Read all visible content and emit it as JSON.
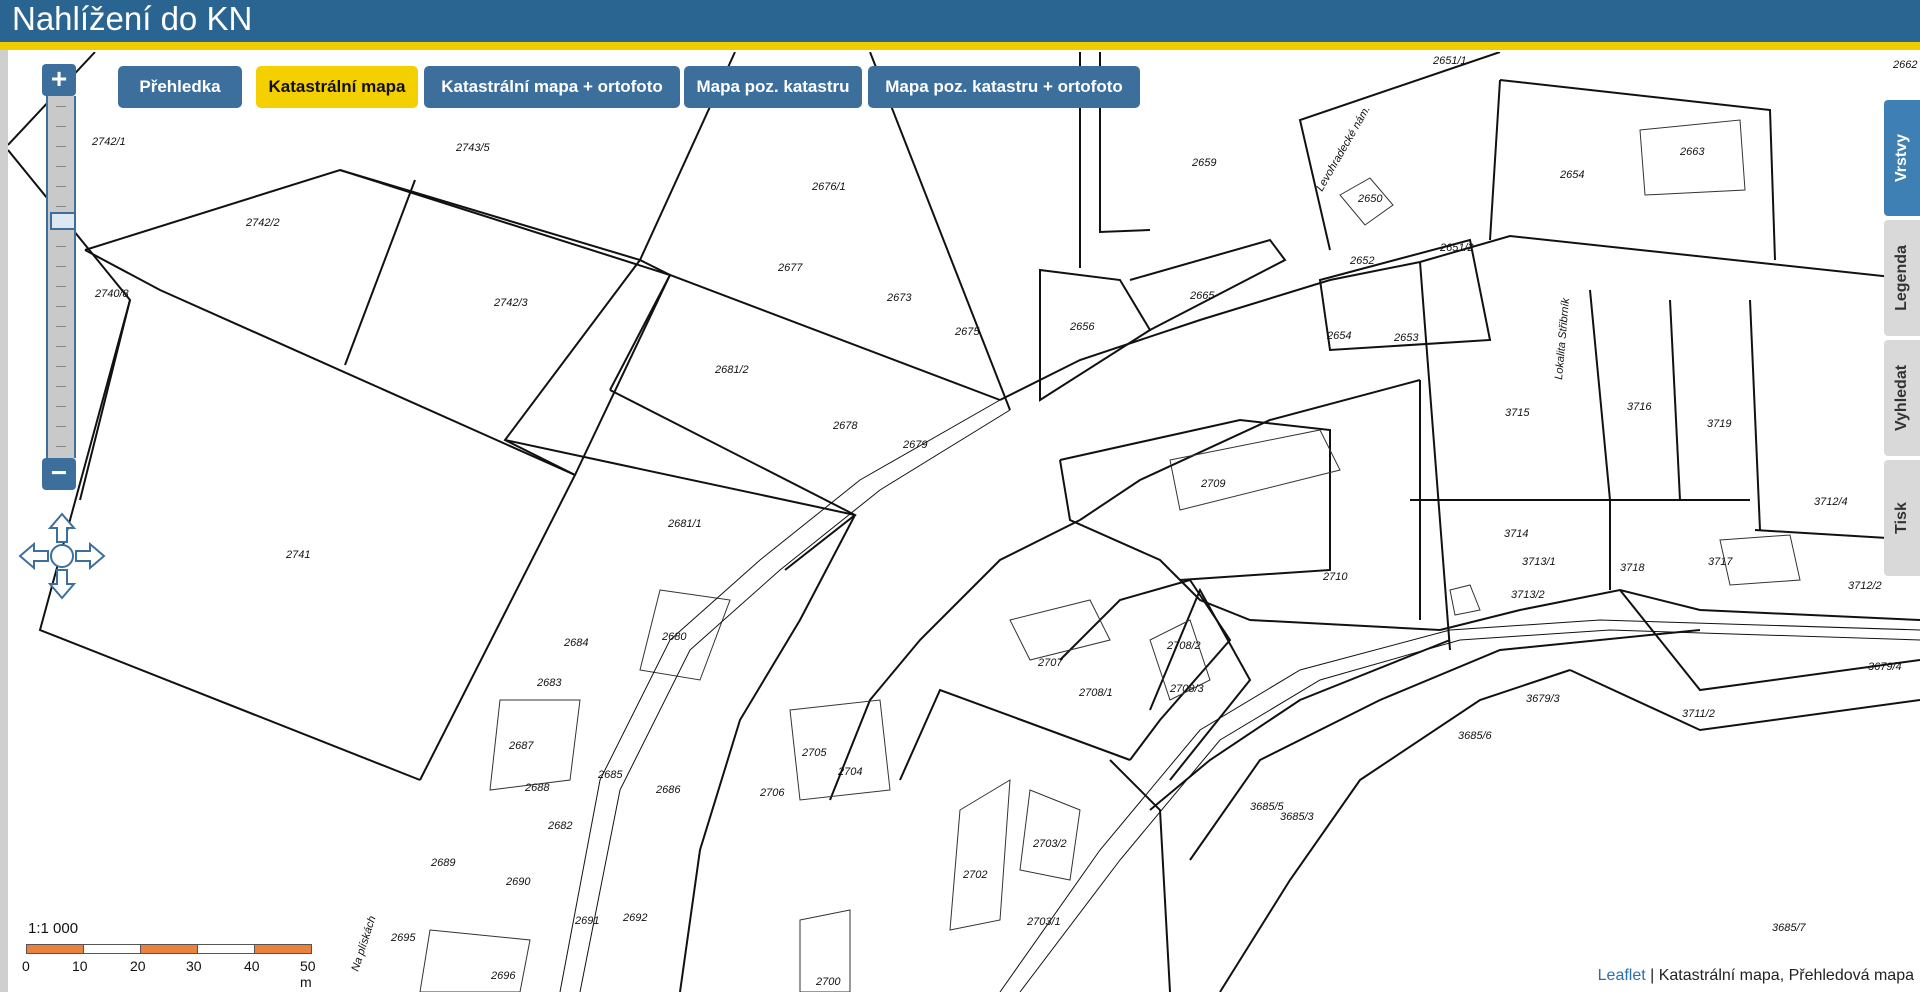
{
  "header": {
    "title": "Nahlížení do KN"
  },
  "zoom": {
    "plus_label": "+",
    "minus_label": "−"
  },
  "layer_tabs": [
    {
      "label": "Přehledka",
      "active": false
    },
    {
      "label": "Katastrální mapa",
      "active": true
    },
    {
      "label": "Katastrální mapa + ortofoto",
      "active": false
    },
    {
      "label": "Mapa poz. katastru",
      "active": false
    },
    {
      "label": "Mapa poz. katastru + ortofoto",
      "active": false
    }
  ],
  "side_tabs": [
    {
      "label": "Vrstvy",
      "active": true
    },
    {
      "label": "Legenda",
      "active": false
    },
    {
      "label": "Vyhledat",
      "active": false
    },
    {
      "label": "Tisk",
      "active": false
    }
  ],
  "scale": {
    "ratio": "1:1 000",
    "labels": [
      "0",
      "10",
      "20",
      "30",
      "40",
      "50 m"
    ]
  },
  "attribution": {
    "link": "Leaflet",
    "text": " | Katastrální mapa, Přehledová mapa"
  },
  "map": {
    "parcel_labels": [
      "2742/1",
      "2742/2",
      "2743/5",
      "2740/8",
      "2742/3",
      "2741",
      "2676/1",
      "2677",
      "2673",
      "2675",
      "2681/2",
      "2678",
      "2679",
      "2681/1",
      "2684",
      "2683",
      "2680",
      "2687",
      "2688",
      "2685",
      "2686",
      "2682",
      "2689",
      "2690",
      "2691",
      "2692",
      "2695",
      "2696",
      "2706",
      "2705",
      "2704",
      "2700",
      "2702",
      "2703/2",
      "2703/1",
      "2707",
      "2708/1",
      "2708/2",
      "2708/3",
      "2709",
      "2710",
      "2651/1",
      "2659",
      "2650",
      "2654",
      "2663",
      "2652",
      "2651/2",
      "2656",
      "2665",
      "2654",
      "2653",
      "3715",
      "3716",
      "3719",
      "3714",
      "3713/1",
      "3713/2",
      "3718",
      "3717",
      "3712/4",
      "3712/2",
      "3679/3",
      "3685/6",
      "3711/2",
      "3679/4",
      "3685/5",
      "3685/3",
      "3685/7",
      "2662"
    ],
    "street_labels": [
      "Lokalita Střibrník",
      "Na plískách",
      "Levohradecké nám."
    ],
    "colors": {
      "header": "#2a6592",
      "accent": "#f0cc00",
      "tab": "#3d6f9c",
      "tab_active": "#f5d000",
      "side_active": "#3f80b4"
    }
  }
}
